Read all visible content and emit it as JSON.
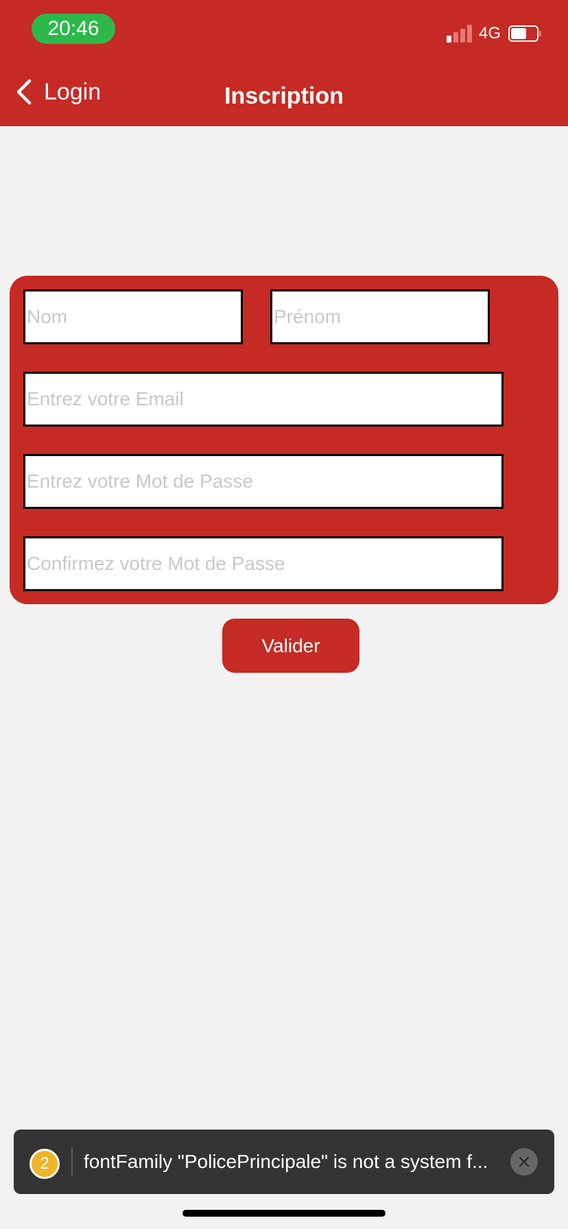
{
  "status_bar": {
    "time": "20:46",
    "network": "4G",
    "icons": [
      "signal-icon",
      "battery-icon"
    ]
  },
  "nav": {
    "back_label": "Login",
    "title": "Inscription"
  },
  "form": {
    "nom_placeholder": "Nom",
    "prenom_placeholder": "Prénom",
    "email_placeholder": "Entrez votre Email",
    "password_placeholder": "Entrez votre Mot de Passe",
    "confirm_placeholder": "Confirmez votre Mot de Passe"
  },
  "submit_label": "Valider",
  "toast": {
    "count": "2",
    "message": "fontFamily \"PolicePrincipale\" is not a system f..."
  },
  "colors": {
    "accent": "#c62a24",
    "background": "#f2f2f2",
    "time_pill": "#2db84a",
    "toast_background": "#333333",
    "toast_badge": "#f0b429"
  }
}
